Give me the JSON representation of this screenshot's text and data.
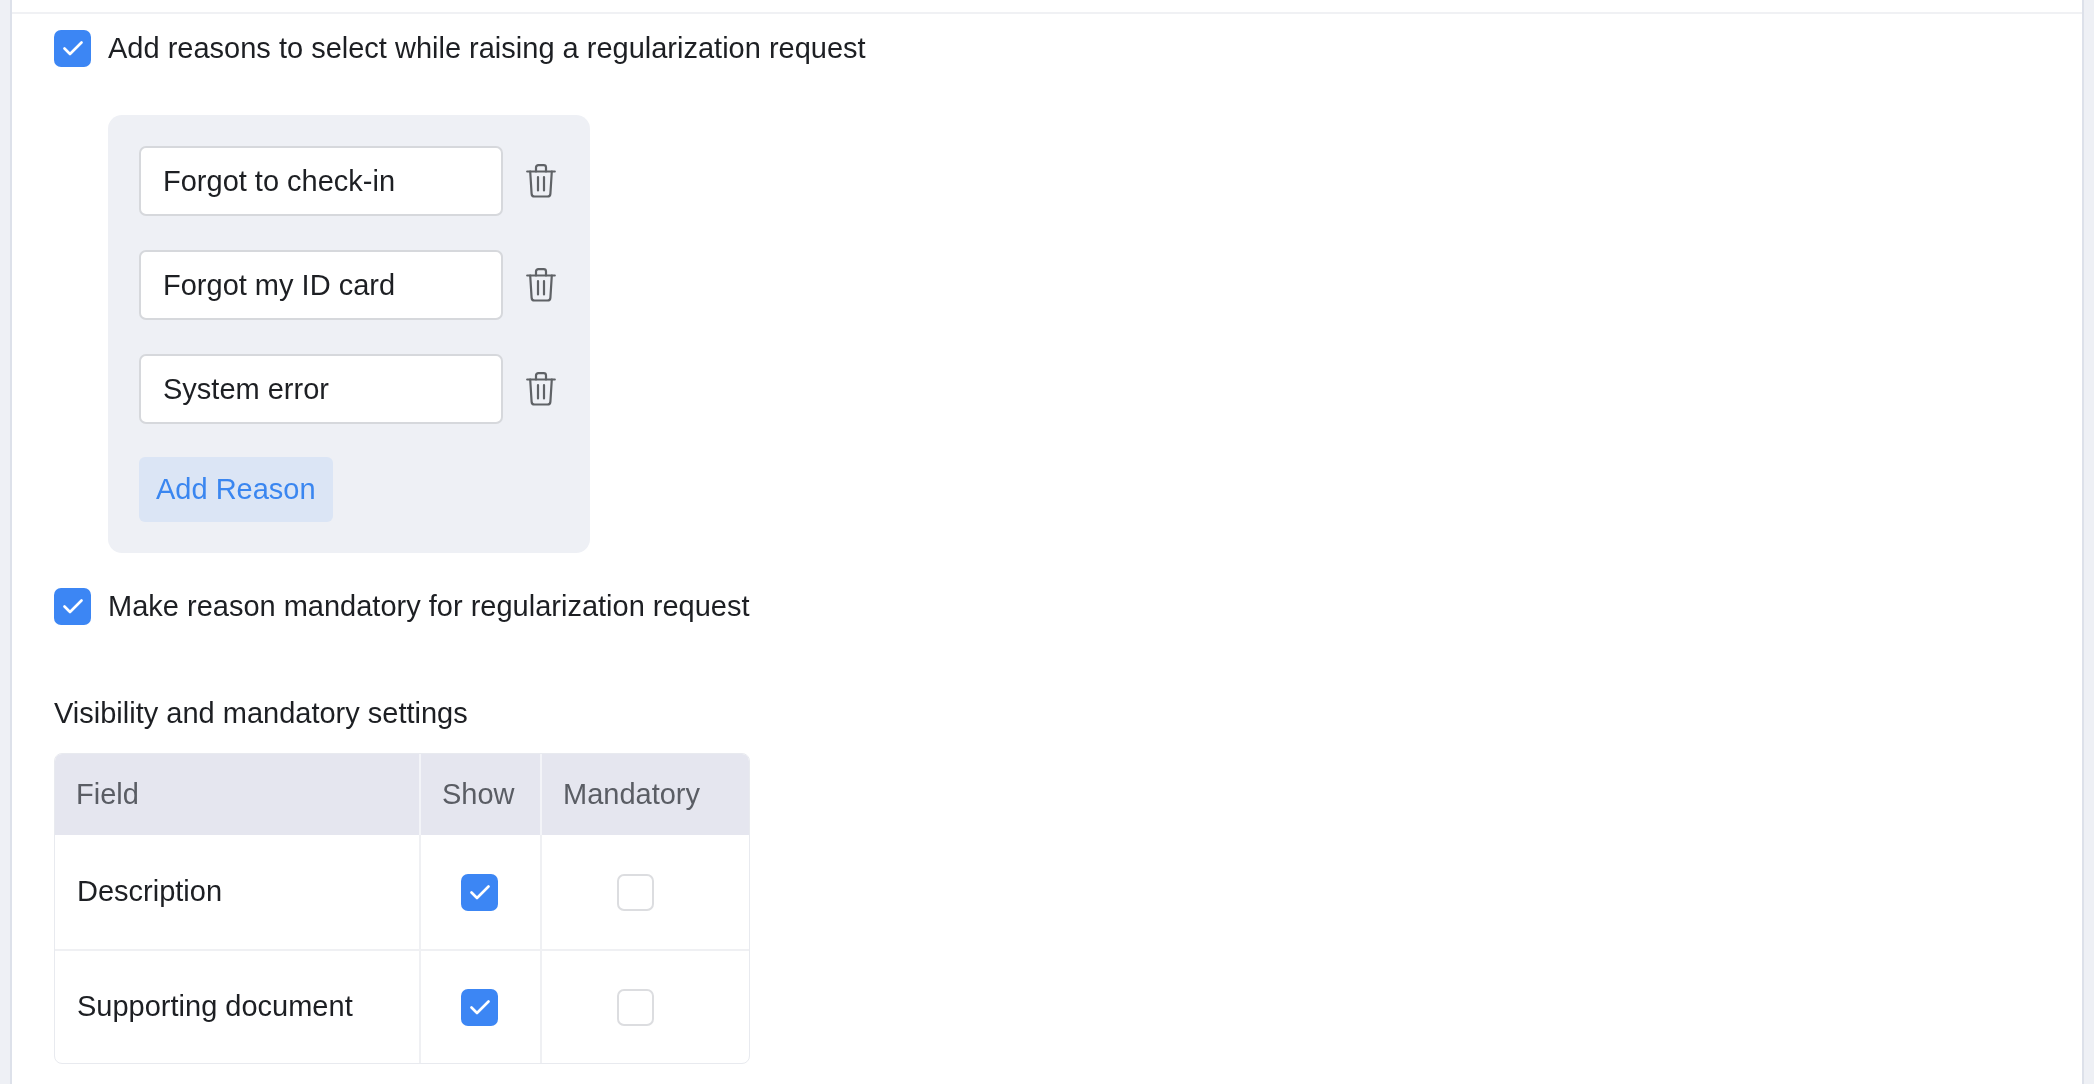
{
  "reasons_option": {
    "label": "Add reasons to select while raising a regularization request",
    "checked": true
  },
  "reasons": [
    "Forgot to check-in",
    "Forgot my ID card",
    "System error"
  ],
  "add_reason_button": "Add Reason",
  "mandatory_option": {
    "label": "Make reason mandatory for regularization request",
    "checked": true
  },
  "visibility_settings": {
    "title": "Visibility and mandatory settings",
    "columns": [
      "Field",
      "Show",
      "Mandatory"
    ],
    "rows": [
      {
        "field": "Description",
        "show": true,
        "mandatory": false
      },
      {
        "field": "Supporting document",
        "show": true,
        "mandatory": false
      }
    ]
  }
}
